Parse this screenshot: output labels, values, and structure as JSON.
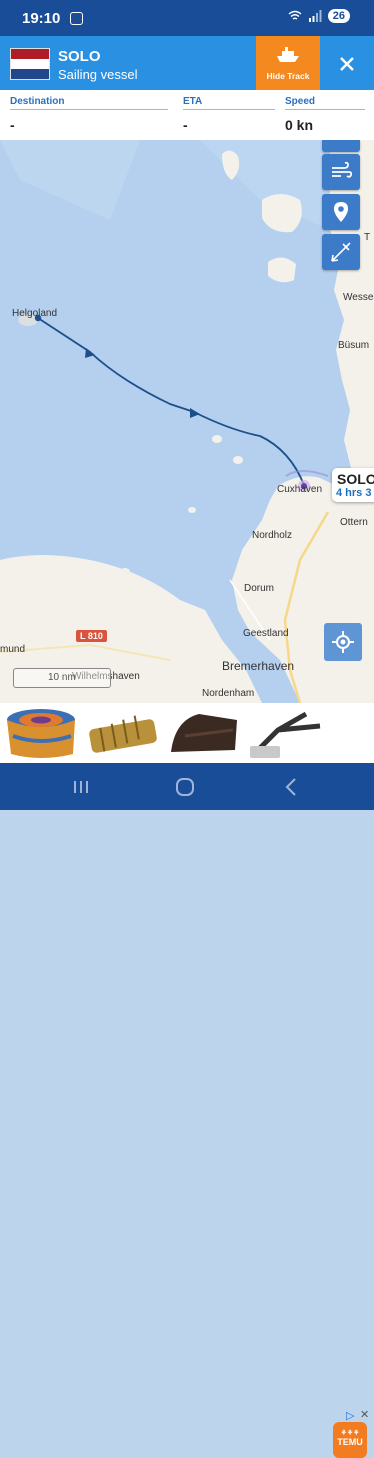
{
  "status_bar": {
    "time": "19:10",
    "battery": "26"
  },
  "header": {
    "vessel_name": "SOLO",
    "vessel_type": "Sailing vessel",
    "hide_track_label": "Hide Track",
    "flag_colors": [
      "#ae1c28",
      "#ffffff",
      "#21468b"
    ]
  },
  "info": {
    "destination_label": "Destination",
    "destination_value": "-",
    "eta_label": "ETA",
    "eta_value": "-",
    "speed_label": "Speed",
    "speed_value": "0 kn"
  },
  "map": {
    "places": {
      "helgoland": "Helgoland",
      "wessel": "Wesse",
      "busum": "Büsum",
      "cuxhaven": "Cuxhaven",
      "ottern": "Ottern",
      "nordholz": "Nordholz",
      "dorum": "Dorum",
      "geestland": "Geestland",
      "bremerhaven": "Bremerhaven",
      "wilhelmshaven": "Wilhelmshaven",
      "nordenham": "Nordenham",
      "mund": "mund",
      "top_right": "T"
    },
    "road_badge": "L 810",
    "scale_label": "10 nm",
    "vessel_label_name": "SOLO",
    "vessel_label_time": "4 hrs 3",
    "colors": {
      "sea": "#b4d0ee",
      "land": "#f3f1ea",
      "track": "#1d4f8c",
      "buttons": "#3c7bc8"
    }
  },
  "ads": {
    "brand": "TEMU",
    "brand_color": "#f47c20"
  },
  "nav_bar": {
    "color": "#1a4d98"
  }
}
